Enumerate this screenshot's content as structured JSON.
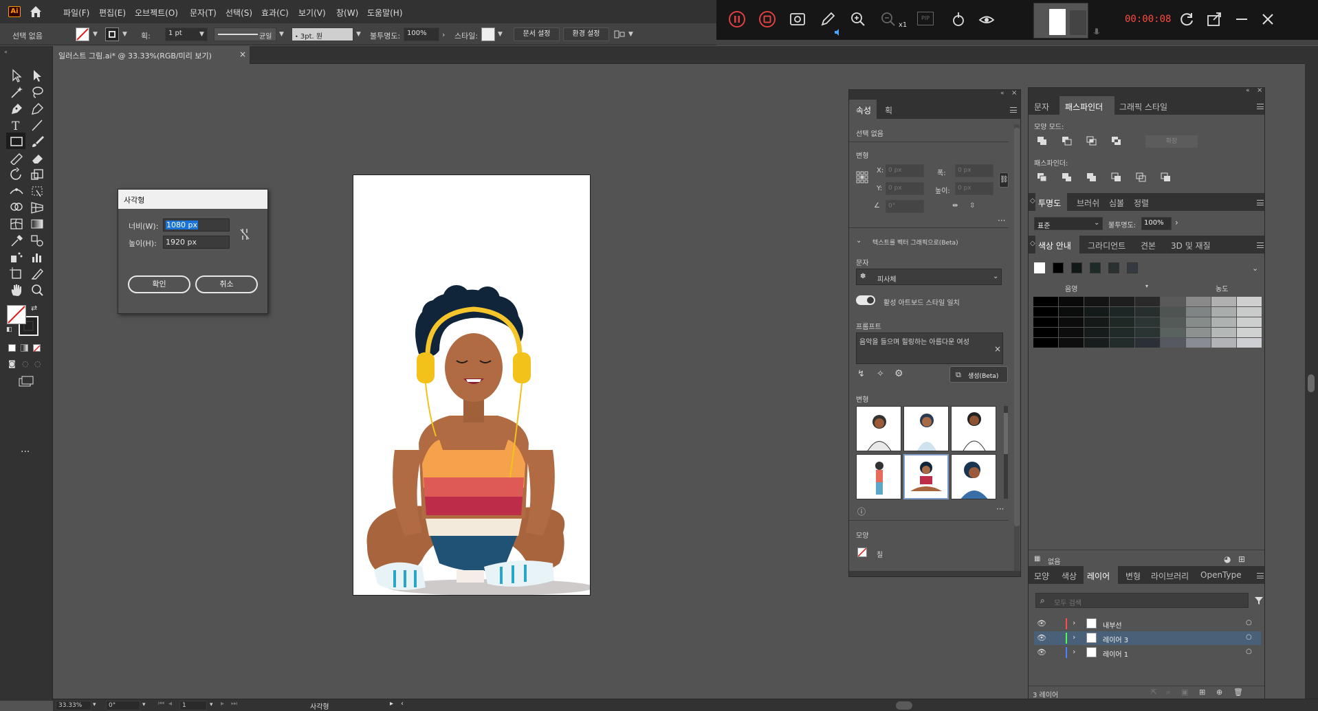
{
  "menubar": {
    "logo": "Ai",
    "items": [
      "파일(F)",
      "편집(E)",
      "오브젝트(O)",
      "문자(T)",
      "선택(S)",
      "효과(C)",
      "보기(V)",
      "창(W)",
      "도움말(H)"
    ]
  },
  "recorder": {
    "zoom_label": "x1",
    "pip_label": "PIP",
    "time": "00:00:08"
  },
  "controlbar": {
    "selection": "선택 없음",
    "stroke_label": "획:",
    "stroke_value": "1 pt",
    "profile_label": "균일",
    "brush_value": "3pt. 원",
    "opacity_label": "불투명도:",
    "opacity_value": "100%",
    "style_label": "스타일:",
    "doc_setup": "문서 설정",
    "preferences": "환경 설정"
  },
  "document": {
    "tab_title": "일러스트 그림.ai* @ 33.33%(RGB/미리 보기)"
  },
  "statusbar": {
    "zoom": "33.33%",
    "rotation": "0°",
    "artboard_num": "1",
    "tool_name": "사각형"
  },
  "dialog": {
    "title": "사각형",
    "width_label": "너비(W):",
    "width_value": "1080 px",
    "height_label": "높이(H):",
    "height_value": "1920 px",
    "ok": "확인",
    "cancel": "취소"
  },
  "properties": {
    "tabs": [
      "속성",
      "획"
    ],
    "selection": "선택 없음",
    "transform_title": "변형",
    "x_label": "X:",
    "x_value": "0 px",
    "y_label": "Y:",
    "y_value": "0 px",
    "w_label": "폭:",
    "w_value": "0 px",
    "h_label": "높이:",
    "h_value": "0 px",
    "angle_value": "0°",
    "text_to_vector": "텍스트를 벡터 그래픽으로(Beta)",
    "type_label": "문자",
    "type_value": "피사체",
    "match_style": "활성 아트보드 스타일 일치",
    "prompt_label": "프롬프트",
    "prompt_value": "음악을 들으며 힐링하는 아름다운  여성",
    "generate": "생성(Beta)",
    "variations_label": "변형",
    "appearance_label": "모양",
    "fill_label": "칠"
  },
  "pathfinder": {
    "tabs": [
      "문자",
      "패스파인더",
      "그래픽 스타일"
    ],
    "shape_modes": "모양 모드:",
    "expand": "확장",
    "pathfinders": "패스파인더:"
  },
  "transparency": {
    "tabs": [
      "투명도",
      "브러쉬",
      "심볼",
      "정렬"
    ],
    "mode": "표준",
    "opacity_label": "불투명도:",
    "opacity_value": "100%"
  },
  "color_guide": {
    "tabs": [
      "색상 안내",
      "그라디언트",
      "견본",
      "3D 및 재질"
    ],
    "shade_label": "음영",
    "tint_label": "농도",
    "harmony_colors": [
      "#ffffff",
      "#000000",
      "#101818",
      "#1e2a28",
      "#2a3130",
      "#353a40"
    ],
    "grid_cols": [
      [
        "#000000",
        "#000000",
        "#000000",
        "#000000",
        "#000000"
      ],
      [
        "#0a0a0a",
        "#0b0c0c",
        "#0c0c0c",
        "#0d0d0d",
        "#0e0e0e"
      ],
      [
        "#141414",
        "#141a1a",
        "#151a19",
        "#161c1b",
        "#171d1c"
      ],
      [
        "#1e1e1e",
        "#1c2624",
        "#1e2926",
        "#202b29",
        "#222c2a"
      ],
      [
        "#2a2a2a",
        "#262f2e",
        "#2b3533",
        "#2a3432",
        "#2b3036"
      ],
      [
        "#5a5a5a",
        "#4e5452",
        "#535a58",
        "#5a625f",
        "#565a60"
      ],
      [
        "#8a8a8a",
        "#7f8584",
        "#868c8a",
        "#8d9290",
        "#898c92"
      ],
      [
        "#b0b0b0",
        "#a9aeac",
        "#aeb2b1",
        "#b4b8b6",
        "#b1b3b7"
      ],
      [
        "#cfcfcf",
        "#c8cbca",
        "#cccfce",
        "#d0d2d1",
        "#cecfd2"
      ]
    ],
    "footer": "없음"
  },
  "layers": {
    "tabs": [
      "모양",
      "색상",
      "레이어",
      "변형",
      "라이브러리",
      "OpenType"
    ],
    "search_placeholder": "모두 검색",
    "rows": [
      {
        "name": "내부선",
        "color": "#ff4d4d"
      },
      {
        "name": "레이어 3",
        "color": "#4dff4d"
      },
      {
        "name": "레이어 1",
        "color": "#4d7fff"
      }
    ],
    "count": "3 레이어"
  }
}
